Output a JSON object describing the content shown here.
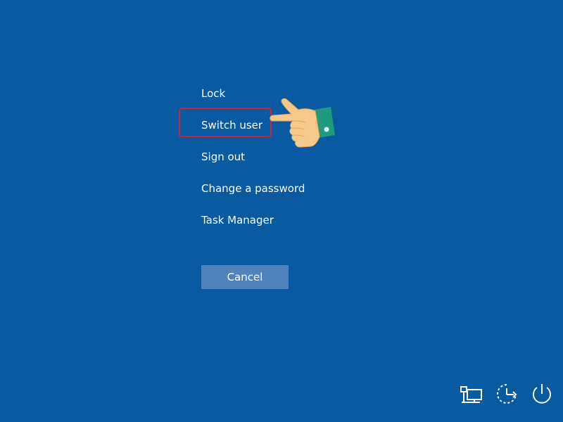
{
  "menu": {
    "items": [
      {
        "label": "Lock"
      },
      {
        "label": "Switch user"
      },
      {
        "label": "Sign out"
      },
      {
        "label": "Change a password"
      },
      {
        "label": "Task Manager"
      }
    ]
  },
  "cancel_label": "Cancel",
  "icons": {
    "pointer": "pointing-hand-icon",
    "network": "network-icon",
    "ease_of_access": "ease-of-access-icon",
    "power": "power-icon"
  },
  "colors": {
    "background": "#0a5aa2",
    "text": "#ffffff",
    "cancel_button": "#4f83bd",
    "highlight": "#d0203a",
    "hand_skin": "#f5c98a",
    "cuff": "#1f9a7f"
  }
}
